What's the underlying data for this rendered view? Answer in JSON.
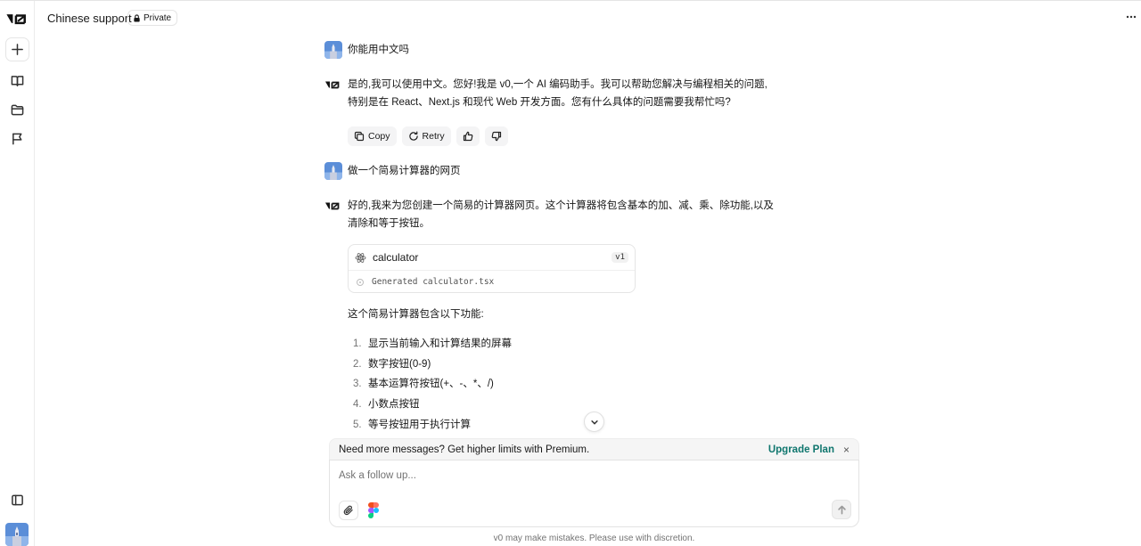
{
  "header": {
    "title": "Chinese support",
    "private_label": "Private"
  },
  "sidebar": {
    "items": [
      {
        "icon": "plus-icon"
      },
      {
        "icon": "book-icon"
      },
      {
        "icon": "folder-icon"
      },
      {
        "icon": "flag-icon"
      }
    ],
    "bottom_icon": "panel-icon"
  },
  "chat": {
    "user_msg_1": "你能用中文吗",
    "assistant_msg_1": {
      "line_1": "是的,我可以使用中文。您好!我是 v0,一个 AI 编码助手。我可以帮助您解决与编程相关的问题,",
      "line_2": "特别是在 React、Next.js 和现代 Web 开发方面。您有什么具体的问题需要我帮忙吗?"
    },
    "actions": {
      "copy": "Copy",
      "retry": "Retry"
    },
    "user_msg_2": "做一个简易计算器的网页",
    "assistant_msg_2": {
      "line_1": "好的,我来为您创建一个简易的计算器网页。这个计算器将包含基本的加、减、乘、除功能,以及",
      "line_2": "清除和等于按钮。"
    },
    "code_card": {
      "title": "calculator",
      "version": "v1",
      "status": "Generated calculator.tsx"
    },
    "features_intro": "这个简易计算器包含以下功能:",
    "features": [
      {
        "num": "1.",
        "text": "显示当前输入和计算结果的屏幕"
      },
      {
        "num": "2.",
        "text": "数字按钮(0-9)"
      },
      {
        "num": "3.",
        "text": "基本运算符按钮(+、-、*、/)"
      },
      {
        "num": "4.",
        "text": "小数点按钮"
      },
      {
        "num": "5.",
        "text": "等号按钮用于执行计算"
      }
    ]
  },
  "premium": {
    "message": "Need more messages? Get higher limits with Premium.",
    "upgrade_label": "Upgrade Plan",
    "close": "×"
  },
  "composer": {
    "placeholder": "Ask a follow up..."
  },
  "footer": {
    "disclaimer": "v0 may make mistakes. Please use with discretion."
  },
  "colors": {
    "accent": "#0f766e",
    "text": "#171717",
    "muted": "#737373",
    "border": "#e5e5e5"
  }
}
